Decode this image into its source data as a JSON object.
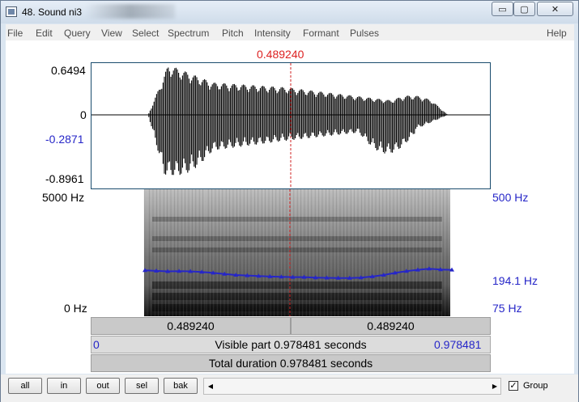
{
  "window": {
    "title": "48. Sound ni3",
    "controls": {
      "minimize": "▭",
      "maximize": "▢",
      "close": "✕"
    }
  },
  "menu": [
    "File",
    "Edit",
    "Query",
    "View",
    "Select",
    "Spectrum",
    "Pitch",
    "Intensity",
    "Formant",
    "Pulses",
    "Help"
  ],
  "cursor": {
    "time": "0.489240"
  },
  "waveform": {
    "ymax": "0.6494",
    "zero": "0",
    "cursor_amp": "-0.2871",
    "ymin": "-0.8961"
  },
  "spectrogram": {
    "fmax": "5000 Hz",
    "fmin": "0 Hz",
    "pitch_top": "500 Hz",
    "pitch_cursor": "194.1 Hz",
    "pitch_bottom": "75 Hz",
    "pitch_track_hz": [
      218,
      216,
      214,
      215,
      214,
      212,
      208,
      204,
      200,
      198,
      196,
      194,
      193,
      192,
      192,
      190,
      189,
      188,
      188,
      190,
      194,
      200,
      208,
      215,
      220,
      224,
      221,
      220
    ]
  },
  "time_bars": {
    "left_segment": "0.489240",
    "right_segment": "0.489240",
    "visible_start": "0",
    "visible_label": "Visible part 0.978481 seconds",
    "visible_end": "0.978481",
    "total_label": "Total duration 0.978481 seconds"
  },
  "bottom": {
    "buttons": [
      "all",
      "in",
      "out",
      "sel",
      "bak"
    ],
    "scroll_left": "◀",
    "scroll_right": "▶",
    "group_checked": "✓",
    "group_label": "Group"
  },
  "colors": {
    "cursor": "#d22222",
    "pitch": "#2626c8",
    "axis_blue": "#2626c8"
  }
}
